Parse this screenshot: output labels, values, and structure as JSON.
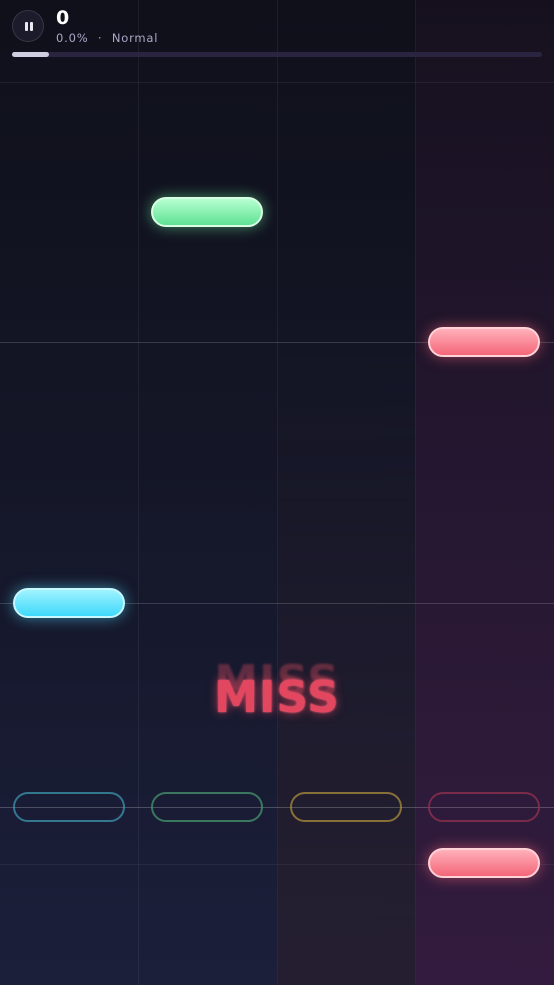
{
  "hud": {
    "score": "0",
    "accuracy": "0.0%",
    "separator": "·",
    "difficulty": "Normal",
    "progress_fraction": 0.07
  },
  "judgement": {
    "text": "MISS"
  },
  "lanes": [
    {
      "index": 0,
      "receptor_color": "#3c96af"
    },
    {
      "index": 1,
      "receptor_color": "#46966e"
    },
    {
      "index": 2,
      "receptor_color": "#aa8c3c"
    },
    {
      "index": 3,
      "receptor_color": "#963250"
    }
  ],
  "notes": [
    {
      "lane": 1,
      "color": "green"
    },
    {
      "lane": 3,
      "color": "red"
    },
    {
      "lane": 0,
      "color": "cyan"
    },
    {
      "lane": 3,
      "color": "red"
    }
  ],
  "colors": {
    "cyan": "#3fd9fb",
    "green": "#5fe294",
    "red": "#f46679",
    "miss": "#e2475f"
  }
}
